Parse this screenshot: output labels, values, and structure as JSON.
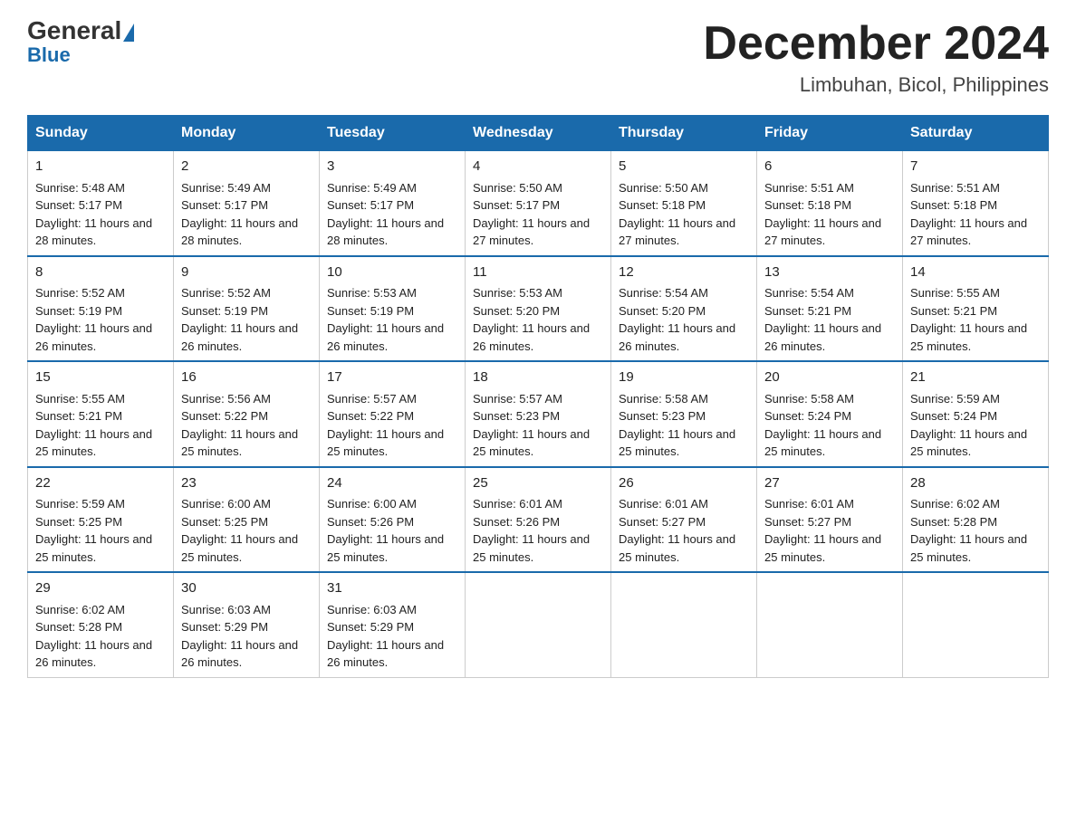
{
  "header": {
    "logo_general": "General",
    "logo_blue": "Blue",
    "month_title": "December 2024",
    "location": "Limbuhan, Bicol, Philippines"
  },
  "days_of_week": [
    "Sunday",
    "Monday",
    "Tuesday",
    "Wednesday",
    "Thursday",
    "Friday",
    "Saturday"
  ],
  "weeks": [
    [
      {
        "day": "1",
        "sunrise": "5:48 AM",
        "sunset": "5:17 PM",
        "daylight": "11 hours and 28 minutes."
      },
      {
        "day": "2",
        "sunrise": "5:49 AM",
        "sunset": "5:17 PM",
        "daylight": "11 hours and 28 minutes."
      },
      {
        "day": "3",
        "sunrise": "5:49 AM",
        "sunset": "5:17 PM",
        "daylight": "11 hours and 28 minutes."
      },
      {
        "day": "4",
        "sunrise": "5:50 AM",
        "sunset": "5:17 PM",
        "daylight": "11 hours and 27 minutes."
      },
      {
        "day": "5",
        "sunrise": "5:50 AM",
        "sunset": "5:18 PM",
        "daylight": "11 hours and 27 minutes."
      },
      {
        "day": "6",
        "sunrise": "5:51 AM",
        "sunset": "5:18 PM",
        "daylight": "11 hours and 27 minutes."
      },
      {
        "day": "7",
        "sunrise": "5:51 AM",
        "sunset": "5:18 PM",
        "daylight": "11 hours and 27 minutes."
      }
    ],
    [
      {
        "day": "8",
        "sunrise": "5:52 AM",
        "sunset": "5:19 PM",
        "daylight": "11 hours and 26 minutes."
      },
      {
        "day": "9",
        "sunrise": "5:52 AM",
        "sunset": "5:19 PM",
        "daylight": "11 hours and 26 minutes."
      },
      {
        "day": "10",
        "sunrise": "5:53 AM",
        "sunset": "5:19 PM",
        "daylight": "11 hours and 26 minutes."
      },
      {
        "day": "11",
        "sunrise": "5:53 AM",
        "sunset": "5:20 PM",
        "daylight": "11 hours and 26 minutes."
      },
      {
        "day": "12",
        "sunrise": "5:54 AM",
        "sunset": "5:20 PM",
        "daylight": "11 hours and 26 minutes."
      },
      {
        "day": "13",
        "sunrise": "5:54 AM",
        "sunset": "5:21 PM",
        "daylight": "11 hours and 26 minutes."
      },
      {
        "day": "14",
        "sunrise": "5:55 AM",
        "sunset": "5:21 PM",
        "daylight": "11 hours and 25 minutes."
      }
    ],
    [
      {
        "day": "15",
        "sunrise": "5:55 AM",
        "sunset": "5:21 PM",
        "daylight": "11 hours and 25 minutes."
      },
      {
        "day": "16",
        "sunrise": "5:56 AM",
        "sunset": "5:22 PM",
        "daylight": "11 hours and 25 minutes."
      },
      {
        "day": "17",
        "sunrise": "5:57 AM",
        "sunset": "5:22 PM",
        "daylight": "11 hours and 25 minutes."
      },
      {
        "day": "18",
        "sunrise": "5:57 AM",
        "sunset": "5:23 PM",
        "daylight": "11 hours and 25 minutes."
      },
      {
        "day": "19",
        "sunrise": "5:58 AM",
        "sunset": "5:23 PM",
        "daylight": "11 hours and 25 minutes."
      },
      {
        "day": "20",
        "sunrise": "5:58 AM",
        "sunset": "5:24 PM",
        "daylight": "11 hours and 25 minutes."
      },
      {
        "day": "21",
        "sunrise": "5:59 AM",
        "sunset": "5:24 PM",
        "daylight": "11 hours and 25 minutes."
      }
    ],
    [
      {
        "day": "22",
        "sunrise": "5:59 AM",
        "sunset": "5:25 PM",
        "daylight": "11 hours and 25 minutes."
      },
      {
        "day": "23",
        "sunrise": "6:00 AM",
        "sunset": "5:25 PM",
        "daylight": "11 hours and 25 minutes."
      },
      {
        "day": "24",
        "sunrise": "6:00 AM",
        "sunset": "5:26 PM",
        "daylight": "11 hours and 25 minutes."
      },
      {
        "day": "25",
        "sunrise": "6:01 AM",
        "sunset": "5:26 PM",
        "daylight": "11 hours and 25 minutes."
      },
      {
        "day": "26",
        "sunrise": "6:01 AM",
        "sunset": "5:27 PM",
        "daylight": "11 hours and 25 minutes."
      },
      {
        "day": "27",
        "sunrise": "6:01 AM",
        "sunset": "5:27 PM",
        "daylight": "11 hours and 25 minutes."
      },
      {
        "day": "28",
        "sunrise": "6:02 AM",
        "sunset": "5:28 PM",
        "daylight": "11 hours and 25 minutes."
      }
    ],
    [
      {
        "day": "29",
        "sunrise": "6:02 AM",
        "sunset": "5:28 PM",
        "daylight": "11 hours and 26 minutes."
      },
      {
        "day": "30",
        "sunrise": "6:03 AM",
        "sunset": "5:29 PM",
        "daylight": "11 hours and 26 minutes."
      },
      {
        "day": "31",
        "sunrise": "6:03 AM",
        "sunset": "5:29 PM",
        "daylight": "11 hours and 26 minutes."
      },
      null,
      null,
      null,
      null
    ]
  ],
  "labels": {
    "sunrise": "Sunrise:",
    "sunset": "Sunset:",
    "daylight": "Daylight:"
  }
}
